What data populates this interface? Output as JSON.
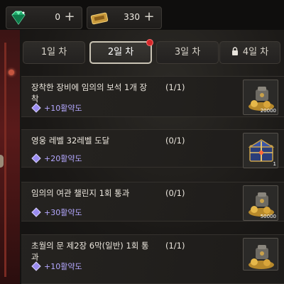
{
  "currencies": {
    "gem": {
      "icon": "green-gem-icon",
      "amount": "0"
    },
    "ticket": {
      "icon": "gold-ticket-icon",
      "amount": "330"
    }
  },
  "tabs": [
    {
      "label": "1일 차",
      "active": false
    },
    {
      "label": "2일 차",
      "active": true,
      "notification": true
    },
    {
      "label": "3일 차",
      "active": false
    },
    {
      "label": "4일 차",
      "active": false,
      "locked": true
    }
  ],
  "quests": [
    {
      "title": "장착한 장비에 임의의 보석 1개 장착",
      "reward": "+10활약도",
      "progress": "(1/1)",
      "item": {
        "icon": "gold-treasure-icon",
        "count": "20000"
      }
    },
    {
      "title": "영웅 레벨 32레벨 도달",
      "reward": "+20활약도",
      "progress": "(0/1)",
      "item": {
        "icon": "treasure-chest-icon",
        "count": "1"
      }
    },
    {
      "title": "임의의 여관 챌린지 1회 통과",
      "reward": "+30활약도",
      "progress": "(0/1)",
      "item": {
        "icon": "gold-treasure-icon",
        "count": "50000"
      }
    },
    {
      "title": "초월의 문 제2장 6막(일반) 1회 통과",
      "reward": "+10활약도",
      "progress": "(1/1)",
      "item": {
        "icon": "gold-treasure-icon",
        "count": ""
      }
    }
  ],
  "colors": {
    "reward_text": "#b4a8ff",
    "notification_dot": "#d4282a"
  }
}
